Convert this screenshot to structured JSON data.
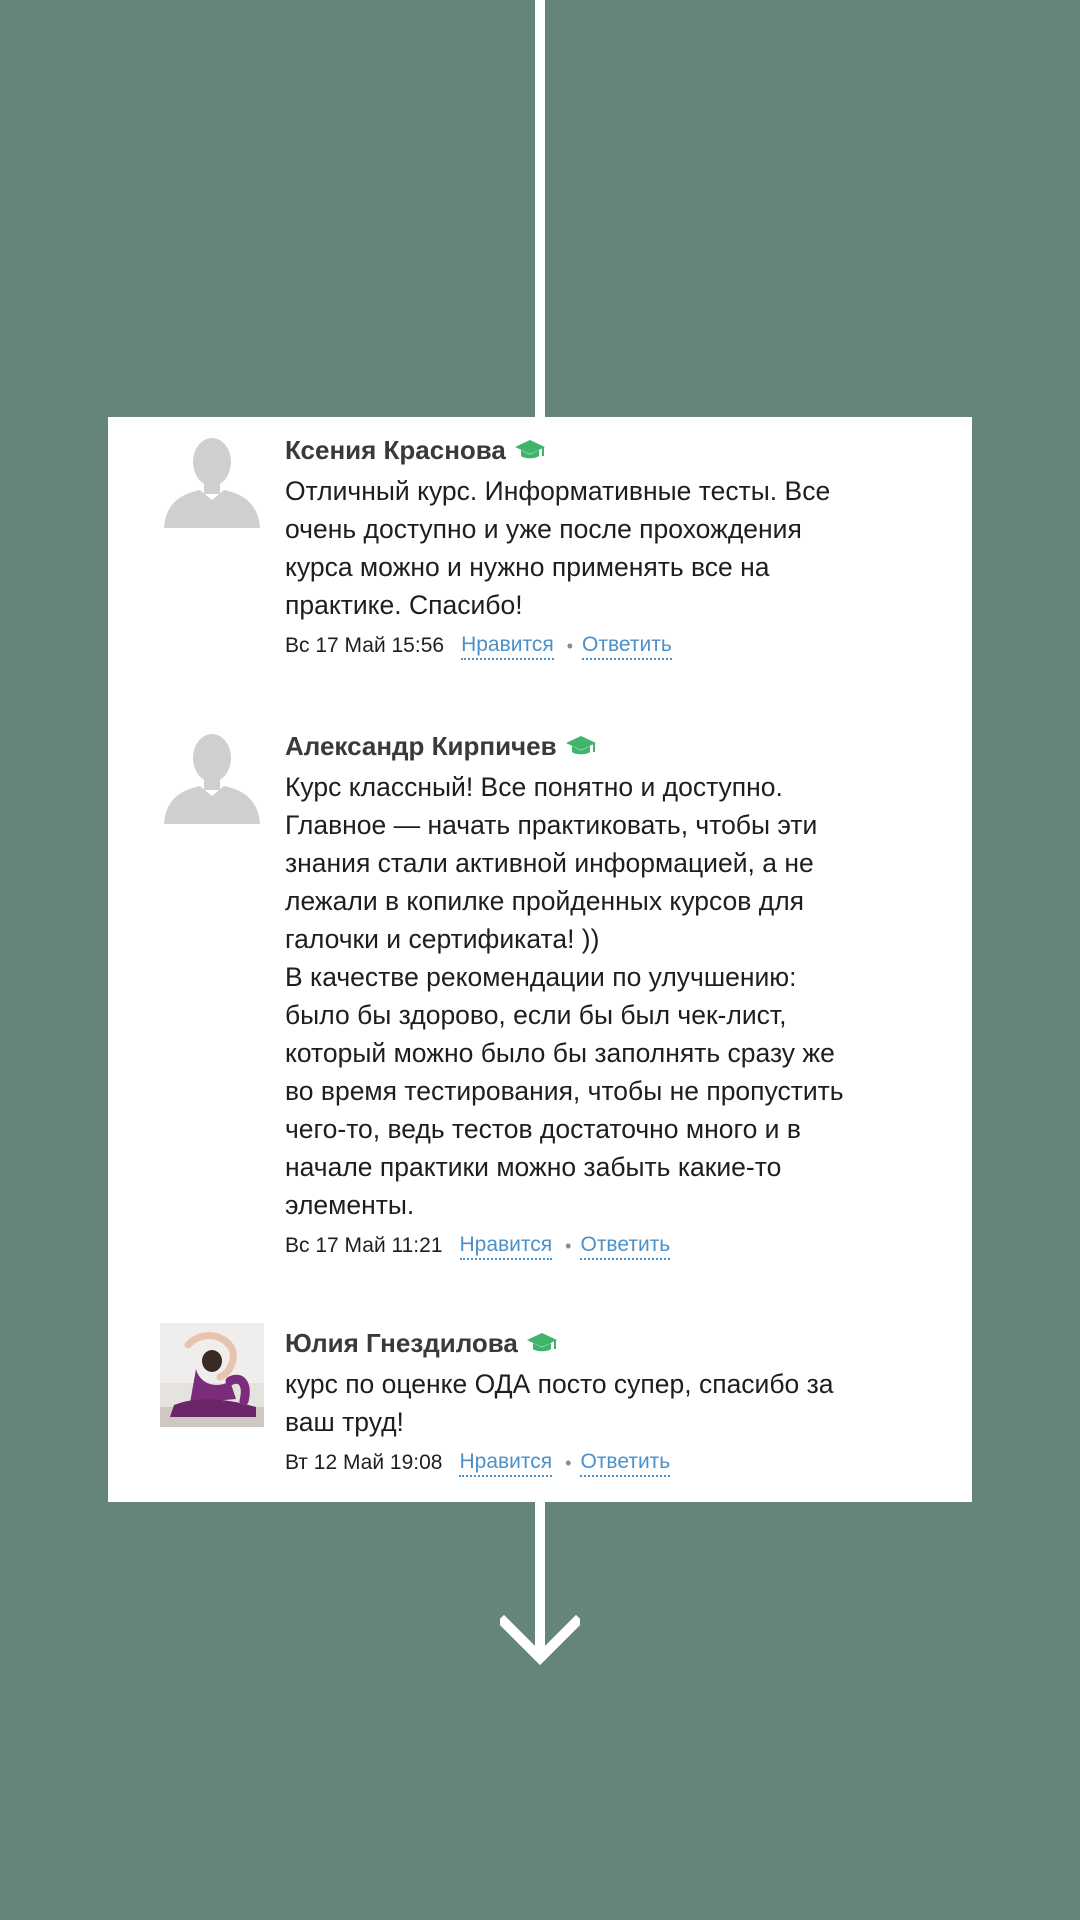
{
  "reviews": [
    {
      "author": "Ксения Краснова",
      "avatar": "default-avatar",
      "text": "Отличный курс. Информативные тесты. Все\nочень доступно и уже после прохождения\nкурса можно и нужно применять все на\nпрактике. Спасибо!",
      "date": "Вс 17 Май 15:56",
      "like_label": "Нравится",
      "reply_label": "Ответить"
    },
    {
      "author": "Александр Кирпичев",
      "avatar": "default-avatar",
      "text": "Курс классный! Все понятно и доступно.\nГлавное — начать практиковать, чтобы эти\nзнания стали активной информацией, а не\nлежали в копилке пройденных курсов для\nгалочки и сертификата! ))\nВ качестве рекомендации по улучшению:\nбыло бы здорово, если бы был чек-лист,\nкоторый можно было бы заполнять сразу же\nво время тестирования, чтобы не пропустить\nчего-то, ведь тестов достаточно много и в\nначале практики можно забыть какие-то\nэлементы.",
      "date": "Вс 17 Май 11:21",
      "like_label": "Нравится",
      "reply_label": "Ответить"
    },
    {
      "author": "Юлия Гнездилова",
      "avatar": "yoga-photo",
      "text": "курс по оценке ОДА посто супер, спасибо за\nваш труд!",
      "date": "Вт 12 Май 19:08",
      "like_label": "Нравится",
      "reply_label": "Ответить"
    }
  ],
  "colors": {
    "background": "#65847a",
    "card": "#ffffff",
    "link": "#4d90c8",
    "badge": "#3fb56b"
  }
}
